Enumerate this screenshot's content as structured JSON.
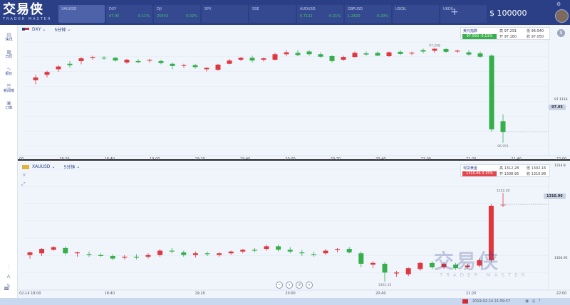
{
  "app": {
    "logo": "交易侠",
    "logo_sub": "TRADER MASTER",
    "balance": "$ 100000"
  },
  "tickers": [
    {
      "sym": "XAUUSD",
      "price": "",
      "change": "",
      "trend": "down",
      "active": true
    },
    {
      "sym": "DXY",
      "price": "97.05",
      "change": "-0.11%",
      "trend": "up",
      "active": false
    },
    {
      "sym": "DJI",
      "price": "25543",
      "change": "0.02%",
      "trend": "up",
      "active": false
    },
    {
      "sym": "SPX",
      "price": "",
      "change": "",
      "trend": "down",
      "active": false
    },
    {
      "sym": "SSE",
      "price": "",
      "change": "",
      "trend": "down",
      "active": false
    },
    {
      "sym": "AUDUSD",
      "price": "0.7132",
      "change": "-0.21%",
      "trend": "up",
      "active": false
    },
    {
      "sym": "GBPUSD",
      "price": "1.2820",
      "change": "-0.29%",
      "trend": "up",
      "active": false
    },
    {
      "sym": "USOIL",
      "price": "",
      "change": "",
      "trend": "down",
      "active": false
    },
    {
      "sym": "UKOIL",
      "price": "",
      "change": "",
      "trend": "down",
      "active": false
    }
  ],
  "sidebar": {
    "items": [
      {
        "label": "快讯",
        "icon": "news-icon"
      },
      {
        "label": "日历",
        "icon": "calendar-icon"
      },
      {
        "label": "报价",
        "icon": "quote-icon"
      },
      {
        "label": "新闻榜",
        "icon": "ranking-icon"
      },
      {
        "label": "订单",
        "icon": "order-icon"
      }
    ]
  },
  "chart_top": {
    "symbol": "DXY",
    "interval": "5分钟",
    "quote": {
      "name": "美元指数",
      "bar": "97.050  -0.11%",
      "high": "高 97.291",
      "low": "低 96.940",
      "open": "开 97.160",
      "close": "收 97.050"
    },
    "price_tag": "97.05",
    "level_label": "97.1116",
    "x_ticks": [
      "00",
      "18:20",
      "18:40",
      "19:00",
      "19:20",
      "19:40",
      "20:00",
      "20:20",
      "20:40",
      "21:00",
      "21:20",
      "21:40",
      "22:00"
    ],
    "high_label": "97.298",
    "low_label": "96.951"
  },
  "chart_bottom": {
    "symbol": "XAUUSD",
    "interval": "5分钟",
    "quote": {
      "name": "现货黄金",
      "bar": "1310.96  0.15%",
      "high": "高 1312.28",
      "low": "低 1302.16",
      "open": "开 1308.95",
      "close": "收 1310.96"
    },
    "price_tag": "1310.96",
    "y_top_label": "1314.8",
    "level_label": "1304.95",
    "x_ticks": [
      "02-14 18:00",
      "18:40",
      "19:20",
      "20:00",
      "20:40",
      "21:20",
      "22:00"
    ],
    "high_label": "1312.28",
    "low_label": "1302.16"
  },
  "watermark": {
    "line1": "交易侠",
    "line2": "TRADER MASTER"
  },
  "statusbar": {
    "datetime": "2019-02-14 21:59:57"
  },
  "chart_data": [
    {
      "type": "candlestick",
      "title": "DXY",
      "x": [
        "18:05",
        "18:10",
        "18:15",
        "18:20",
        "18:25",
        "18:30",
        "18:35",
        "18:40",
        "18:45",
        "18:50",
        "18:55",
        "19:00",
        "19:05",
        "19:10",
        "19:15",
        "19:20",
        "19:25",
        "19:30",
        "19:35",
        "19:40",
        "19:45",
        "19:50",
        "19:55",
        "20:00",
        "20:05",
        "20:10",
        "20:15",
        "20:20",
        "20:25",
        "20:30",
        "20:35",
        "20:40",
        "20:45",
        "20:50",
        "20:55",
        "21:00",
        "21:05",
        "21:10",
        "21:15",
        "21:20",
        "21:25",
        "21:30"
      ],
      "ohlc": [
        [
          97.18,
          97.2,
          97.165,
          97.19
        ],
        [
          97.2,
          97.215,
          97.19,
          97.21
        ],
        [
          97.22,
          97.235,
          97.21,
          97.23
        ],
        [
          97.24,
          97.25,
          97.225,
          97.235
        ],
        [
          97.25,
          97.265,
          97.238,
          97.26
        ],
        [
          97.262,
          97.27,
          97.255,
          97.265
        ],
        [
          97.262,
          97.268,
          97.255,
          97.26
        ],
        [
          97.262,
          97.265,
          97.248,
          97.252
        ],
        [
          97.245,
          97.258,
          97.24,
          97.255
        ],
        [
          97.25,
          97.258,
          97.243,
          97.246
        ],
        [
          97.252,
          97.258,
          97.245,
          97.255
        ],
        [
          97.25,
          97.255,
          97.238,
          97.243
        ],
        [
          97.24,
          97.245,
          97.22,
          97.232
        ],
        [
          97.235,
          97.24,
          97.225,
          97.235
        ],
        [
          97.235,
          97.24,
          97.222,
          97.228
        ],
        [
          97.22,
          97.228,
          97.212,
          97.225
        ],
        [
          97.218,
          97.24,
          97.215,
          97.237
        ],
        [
          97.24,
          97.258,
          97.238,
          97.252
        ],
        [
          97.255,
          97.265,
          97.25,
          97.262
        ],
        [
          97.262,
          97.27,
          97.245,
          97.252
        ],
        [
          97.255,
          97.263,
          97.248,
          97.26
        ],
        [
          97.255,
          97.28,
          97.252,
          97.275
        ],
        [
          97.275,
          97.29,
          97.268,
          97.282
        ],
        [
          97.28,
          97.29,
          97.268,
          97.272
        ],
        [
          97.285,
          97.29,
          97.27,
          97.275
        ],
        [
          97.275,
          97.282,
          97.262,
          97.266
        ],
        [
          97.268,
          97.272,
          97.245,
          97.25
        ],
        [
          97.255,
          97.27,
          97.25,
          97.265
        ],
        [
          97.265,
          97.285,
          97.262,
          97.28
        ],
        [
          97.278,
          97.285,
          97.27,
          97.274
        ],
        [
          97.28,
          97.285,
          97.268,
          97.27
        ],
        [
          97.268,
          97.285,
          97.265,
          97.282
        ],
        [
          97.284,
          97.29,
          97.272,
          97.276
        ],
        [
          97.28,
          97.285,
          97.272,
          97.28
        ],
        [
          97.29,
          97.296,
          97.278,
          97.285
        ],
        [
          97.288,
          97.298,
          97.28,
          97.295
        ],
        [
          97.294,
          97.298,
          97.28,
          97.284
        ],
        [
          97.285,
          97.292,
          97.28,
          97.288
        ],
        [
          97.282,
          97.29,
          97.27,
          97.274
        ],
        [
          97.278,
          97.285,
          97.262,
          97.266
        ],
        [
          97.27,
          97.275,
          96.99,
          97.0
        ],
        [
          97.03,
          97.055,
          96.951,
          96.99
        ]
      ],
      "ylim": [
        96.94,
        97.32
      ],
      "labels": {
        "high": "97.298",
        "low": "96.951",
        "level": "97.1116",
        "current": "97.05"
      }
    },
    {
      "type": "candlestick",
      "title": "XAUUSD",
      "x": [
        "18:05",
        "18:10",
        "18:15",
        "18:20",
        "18:25",
        "18:30",
        "18:35",
        "18:40",
        "18:45",
        "18:50",
        "18:55",
        "19:00",
        "19:05",
        "19:10",
        "19:15",
        "19:20",
        "19:25",
        "19:30",
        "19:35",
        "19:40",
        "19:45",
        "19:50",
        "19:55",
        "20:00",
        "20:05",
        "20:10",
        "20:15",
        "20:20",
        "20:25",
        "20:30",
        "20:35",
        "20:40",
        "20:45",
        "20:50",
        "20:55",
        "21:00",
        "21:05",
        "21:10",
        "21:15",
        "21:20",
        "21:25",
        "21:30"
      ],
      "ohlc": [
        [
          1305.2,
          1305.6,
          1304.8,
          1305.5
        ],
        [
          1305.4,
          1306.0,
          1305.1,
          1305.9
        ],
        [
          1305.8,
          1306.2,
          1305.7,
          1306.1
        ],
        [
          1306.0,
          1306.2,
          1305.2,
          1305.4
        ],
        [
          1305.4,
          1305.6,
          1305.0,
          1305.5
        ],
        [
          1305.3,
          1305.6,
          1305.0,
          1305.2
        ],
        [
          1305.2,
          1305.4,
          1305.0,
          1305.1
        ],
        [
          1305.1,
          1305.3,
          1304.6,
          1304.8
        ],
        [
          1304.9,
          1305.2,
          1304.7,
          1305.0
        ],
        [
          1305.0,
          1305.3,
          1304.7,
          1304.9
        ],
        [
          1305.0,
          1305.4,
          1304.8,
          1305.2
        ],
        [
          1305.2,
          1305.9,
          1305.0,
          1305.7
        ],
        [
          1305.7,
          1306.0,
          1305.4,
          1305.6
        ],
        [
          1305.5,
          1305.7,
          1305.0,
          1305.2
        ],
        [
          1305.2,
          1305.6,
          1304.9,
          1305.4
        ],
        [
          1305.4,
          1305.6,
          1305.1,
          1305.3
        ],
        [
          1305.2,
          1305.5,
          1305.0,
          1305.4
        ],
        [
          1305.4,
          1305.7,
          1305.2,
          1305.6
        ],
        [
          1305.6,
          1305.9,
          1305.4,
          1305.8
        ],
        [
          1305.8,
          1306.0,
          1305.5,
          1305.7
        ],
        [
          1305.9,
          1306.4,
          1305.7,
          1306.2
        ],
        [
          1306.2,
          1306.4,
          1305.6,
          1305.8
        ],
        [
          1305.8,
          1306.1,
          1305.4,
          1305.6
        ],
        [
          1305.5,
          1305.8,
          1305.1,
          1305.4
        ],
        [
          1305.3,
          1305.6,
          1305.0,
          1305.2
        ],
        [
          1305.4,
          1305.9,
          1305.2,
          1305.7
        ],
        [
          1305.8,
          1306.0,
          1305.5,
          1305.9
        ],
        [
          1305.9,
          1306.1,
          1305.4,
          1305.5
        ],
        [
          1305.4,
          1305.6,
          1303.8,
          1304.2
        ],
        [
          1304.1,
          1304.5,
          1303.7,
          1304.3
        ],
        [
          1304.2,
          1304.4,
          1302.16,
          1303.2
        ],
        [
          1303.1,
          1303.4,
          1302.7,
          1303.2
        ],
        [
          1303.0,
          1303.8,
          1302.8,
          1303.7
        ],
        [
          1303.6,
          1304.4,
          1303.4,
          1304.3
        ],
        [
          1304.3,
          1304.5,
          1303.6,
          1303.8
        ],
        [
          1303.8,
          1304.4,
          1303.6,
          1304.2
        ],
        [
          1304.1,
          1304.3,
          1303.5,
          1303.7
        ],
        [
          1303.8,
          1304.2,
          1303.6,
          1304.0
        ],
        [
          1304.0,
          1304.8,
          1303.8,
          1304.6
        ],
        [
          1304.6,
          1311.0,
          1304.4,
          1310.8
        ],
        [
          1310.9,
          1312.28,
          1310.7,
          1310.96
        ]
      ],
      "ylim": [
        1301.2,
        1315.0
      ],
      "labels": {
        "high": "1312.28",
        "low": "1302.16",
        "level": "1304.95",
        "top": "1314.8",
        "current": "1310.96"
      }
    }
  ]
}
